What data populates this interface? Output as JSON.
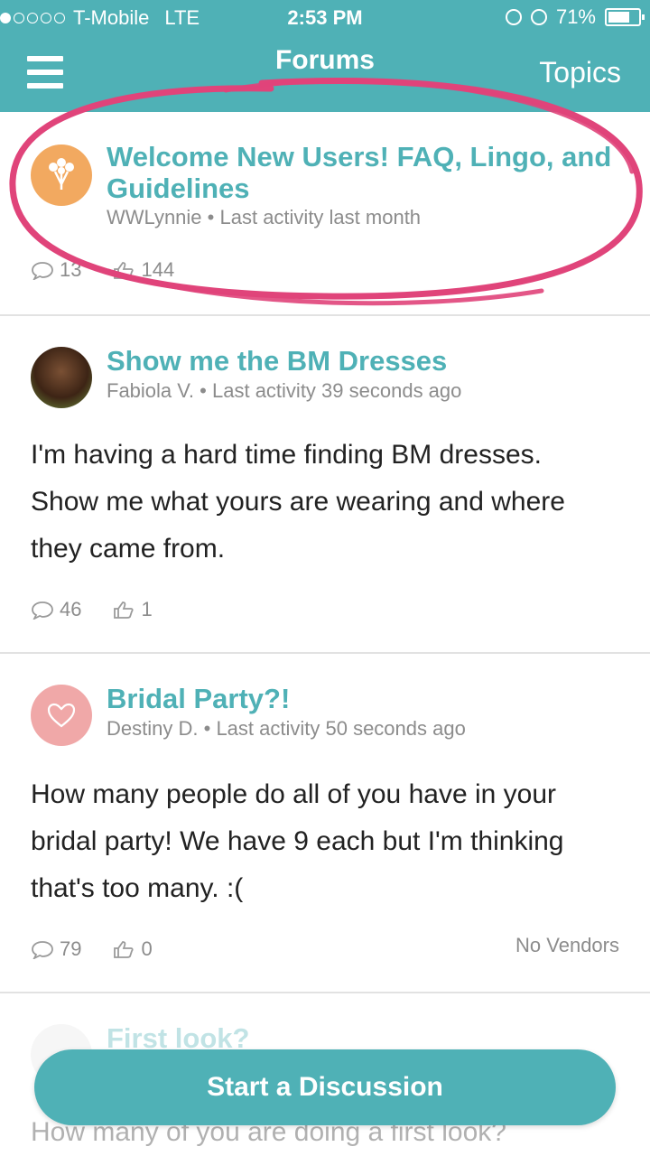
{
  "status_bar": {
    "carrier": "T-Mobile",
    "network": "LTE",
    "time": "2:53 PM",
    "battery": "71%",
    "battery_level": 0.71
  },
  "nav": {
    "title": "Forums",
    "right_action": "Topics"
  },
  "threads": [
    {
      "title": "Welcome New Users! FAQ, Lingo, and Guidelines",
      "author": "WWLynnie",
      "activity": "Last activity last month",
      "body": "",
      "comments": "13",
      "likes": "144",
      "vendor_label": ""
    },
    {
      "title": "Show me the BM Dresses",
      "author": "Fabiola V.",
      "activity": "Last activity 39 seconds ago",
      "body": "I'm having a hard time finding BM dresses. Show me what yours are wearing and where they came from.",
      "comments": "46",
      "likes": "1",
      "vendor_label": ""
    },
    {
      "title": "Bridal Party?!",
      "author": "Destiny D.",
      "activity": "Last activity 50 seconds ago",
      "body": "How many people do all of you have in your bridal party! We have 9 each but I'm thinking that's too many. :(",
      "comments": "79",
      "likes": "0",
      "vendor_label": "No Vendors"
    },
    {
      "title": "First look?",
      "author": "",
      "activity": "",
      "body": "How many of you are doing a first look?",
      "comments": "",
      "likes": "",
      "vendor_label": ""
    }
  ],
  "meta_separator": "•",
  "fab": {
    "label": "Start a Discussion"
  },
  "colors": {
    "brand": "#4fb1b6",
    "annotation": "#e0447a",
    "orange_avatar": "#f2a960",
    "pink_avatar": "#f0a8a8"
  },
  "icons": [
    "menu-icon",
    "bouquet-icon",
    "heart-icon",
    "comment-icon",
    "thumbs-up-icon"
  ]
}
